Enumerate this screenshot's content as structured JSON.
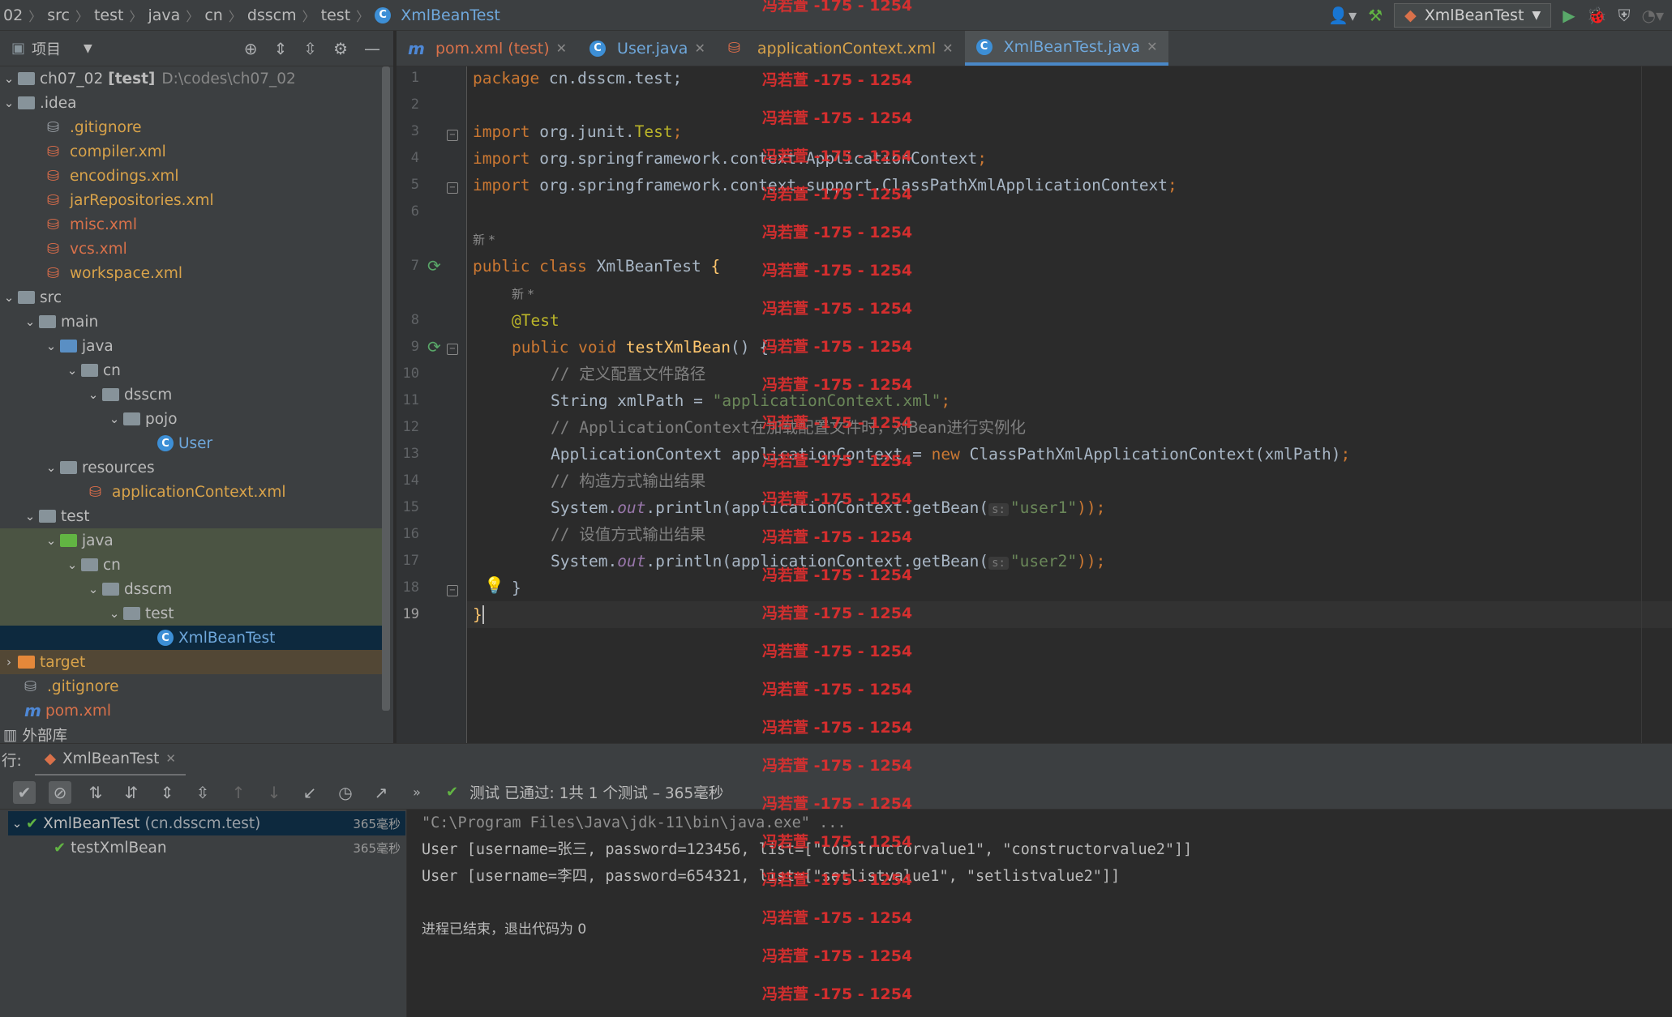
{
  "breadcrumb": {
    "items": [
      "02",
      "src",
      "test",
      "java",
      "cn",
      "dsscm",
      "test"
    ],
    "current": "XmlBeanTest"
  },
  "toolbar": {
    "run_config": "XmlBeanTest"
  },
  "project_panel": {
    "title": "项目",
    "tree": [
      {
        "label": "ch07_02",
        "suffix": "[test]",
        "path": "D:\\codes\\ch07_02"
      },
      {
        "label": ".idea"
      },
      {
        "label": ".gitignore"
      },
      {
        "label": "compiler.xml"
      },
      {
        "label": "encodings.xml"
      },
      {
        "label": "jarRepositories.xml"
      },
      {
        "label": "misc.xml"
      },
      {
        "label": "vcs.xml"
      },
      {
        "label": "workspace.xml"
      },
      {
        "label": "src"
      },
      {
        "label": "main"
      },
      {
        "label": "java"
      },
      {
        "label": "cn"
      },
      {
        "label": "dsscm"
      },
      {
        "label": "pojo"
      },
      {
        "label": "User"
      },
      {
        "label": "resources"
      },
      {
        "label": "applicationContext.xml"
      },
      {
        "label": "test"
      },
      {
        "label": "java"
      },
      {
        "label": "cn"
      },
      {
        "label": "dsscm"
      },
      {
        "label": "test"
      },
      {
        "label": "XmlBeanTest"
      },
      {
        "label": "target"
      },
      {
        "label": ".gitignore"
      },
      {
        "label": "pom.xml"
      },
      {
        "label": "外部库"
      }
    ]
  },
  "tabs": [
    {
      "label": "pom.xml (test)"
    },
    {
      "label": "User.java"
    },
    {
      "label": "applicationContext.xml"
    },
    {
      "label": "XmlBeanTest.java"
    }
  ],
  "editor": {
    "line_numbers": [
      "1",
      "2",
      "3",
      "4",
      "5",
      "6",
      "7",
      "8",
      "9",
      "10",
      "11",
      "12",
      "13",
      "14",
      "15",
      "16",
      "17",
      "18",
      "19"
    ],
    "author_hint": "新 *",
    "code": {
      "l1_kw": "package",
      "l1_rest": " cn.dsscm.test;",
      "l3_kw": "import",
      "l3_pkg": " org.junit.",
      "l3_cls": "Test",
      "l3_end": ";",
      "l4_kw": "import",
      "l4_rest": " org.springframework.context.ApplicationContext",
      "l4_end": ";",
      "l5_kw": "import",
      "l5_rest": " org.springframework.context.support.ClassPathXmlApplicationContext",
      "l5_end": ";",
      "l7_kw": "public class",
      "l7_name": " XmlBeanTest ",
      "l7_brace": "{",
      "l8_ann": "@Test",
      "l9_kw": "public void",
      "l9_fn": " testXmlBean",
      "l9_rest": "() {",
      "l10_cmt": "// 定义配置文件路径",
      "l11_a": "String xmlPath = ",
      "l11_str": "\"applicationContext.xml\"",
      "l11_end": ";",
      "l12_cmt": "// ApplicationContext在加载配置文件时，对Bean进行实例化",
      "l13_a": "ApplicationContext applicationContext = ",
      "l13_kw": "new",
      "l13_b": " ClassPathXmlApplicationContext(xmlPath)",
      "l13_end": ";",
      "l14_cmt": "// 构造方式输出结果",
      "l15_a": "System.",
      "l15_fld": "out",
      "l15_b": ".println(applicationContext.getBean(",
      "l15_hint": "s:",
      "l15_str": "\"user1\"",
      "l15_end": "));",
      "l16_cmt": "// 设值方式输出结果",
      "l17_a": "System.",
      "l17_fld": "out",
      "l17_b": ".println(applicationContext.getBean(",
      "l17_hint": "s:",
      "l17_str": "\"user2\"",
      "l17_end": "));",
      "l18": "}",
      "l19": "}"
    }
  },
  "run_panel": {
    "prefix": "行:",
    "tab_label": "XmlBeanTest",
    "status": "测试 已通过: 1共 1 个测试 – 365毫秒",
    "tests": [
      {
        "name": "XmlBeanTest",
        "pkg": "(cn.dsscm.test)",
        "time": "365毫秒"
      },
      {
        "name": "testXmlBean",
        "time": "365毫秒"
      }
    ],
    "console": [
      "\"C:\\Program Files\\Java\\jdk-11\\bin\\java.exe\" ...",
      "User [username=张三, password=123456, list=[\"constructorvalue1\", \"constructorvalue2\"]]",
      "User [username=李四, password=654321, list=[\"setlistvalue1\", \"setlistvalue2\"]]",
      "进程已结束，退出代码为 0"
    ]
  },
  "watermark": "冯若萱 -175 - 1254",
  "colors": {
    "accent": "#4a88c7",
    "pass": "#62b543",
    "watermark": "#e32f2f"
  }
}
